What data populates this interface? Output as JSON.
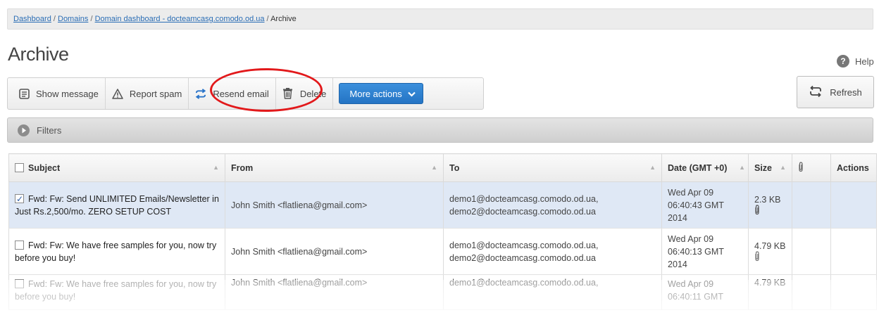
{
  "breadcrumb": {
    "items": [
      "Dashboard",
      "Domains",
      "Domain dashboard - docteamcasg.comodo.od.ua"
    ],
    "current": "Archive",
    "separator": " / "
  },
  "page": {
    "title": "Archive"
  },
  "help": {
    "label": "Help",
    "icon": "help-icon"
  },
  "toolbar": {
    "show_message": "Show message",
    "report_spam": "Report spam",
    "resend_email": "Resend email",
    "delete": "Delete",
    "more_actions": "More actions"
  },
  "refresh": {
    "label": "Refresh"
  },
  "filters": {
    "label": "Filters"
  },
  "table": {
    "headers": {
      "subject": "Subject",
      "from": "From",
      "to": "To",
      "date": "Date (GMT +0)",
      "size": "Size",
      "actions": "Actions"
    },
    "rows": [
      {
        "checked": true,
        "subject": "Fwd: Fw: Send UNLIMITED Emails/Newsletter in Just Rs.2,500/mo. ZERO SETUP COST",
        "from": "John Smith <flatliena@gmail.com>",
        "to": "demo1@docteamcasg.comodo.od.ua, demo2@docteamcasg.comodo.od.ua",
        "date": "Wed Apr 09 06:40:43 GMT 2014",
        "size": "2.3 KB",
        "attachment": true
      },
      {
        "checked": false,
        "subject": "Fwd: Fw: We have free samples for you, now try before you buy!",
        "from": "John Smith <flatliena@gmail.com>",
        "to": "demo1@docteamcasg.comodo.od.ua, demo2@docteamcasg.comodo.od.ua",
        "date": "Wed Apr 09 06:40:13 GMT 2014",
        "size": "4.79 KB",
        "attachment": true
      },
      {
        "checked": false,
        "subject": "Fwd: Fw: We have free samples for you, now try before you buy!",
        "from": "John Smith <flatliena@gmail.com>",
        "to": "demo1@docteamcasg.comodo.od.ua,",
        "date": "Wed Apr 09 06:40:11 GMT",
        "size": "4.79 KB",
        "attachment": true
      }
    ]
  },
  "colors": {
    "accent": "#2474c4",
    "selected_row": "#dfe8f5",
    "highlight": "#e2191b",
    "link": "#2a6db5"
  }
}
